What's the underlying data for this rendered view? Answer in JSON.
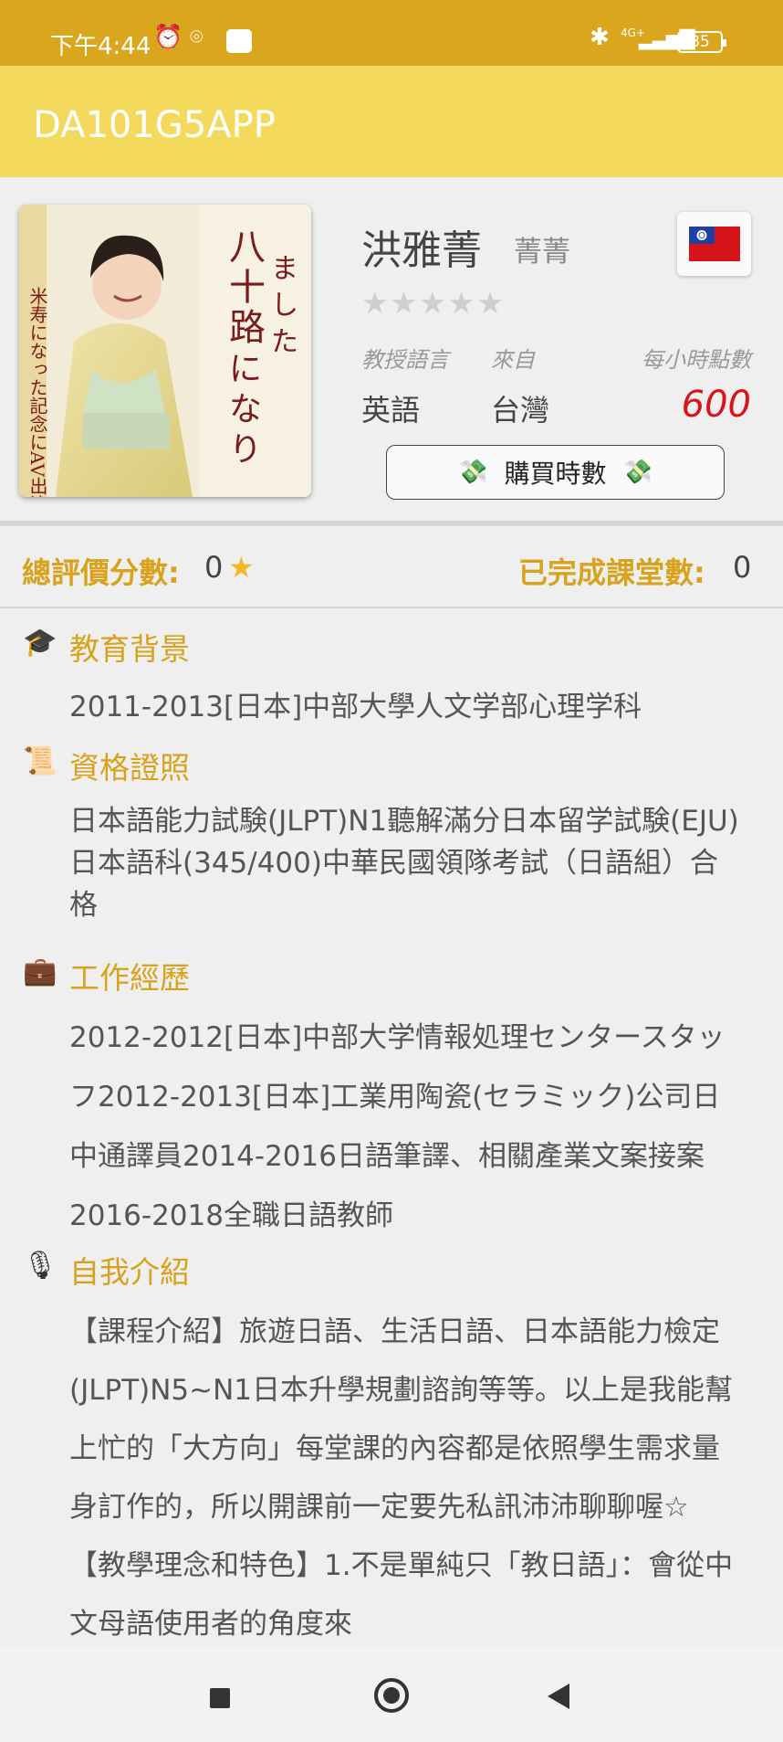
{
  "status_bar": {
    "time": "下午4:44",
    "network": "4G+",
    "battery": "85",
    "icons": [
      "alarm-icon",
      "app-notification-icon",
      "app-square-icon",
      "bluetooth-icon",
      "signal-icon"
    ]
  },
  "app_bar": {
    "title": "DA101G5APP"
  },
  "teacher": {
    "name": "洪雅菁",
    "nickname": "菁菁",
    "flag": "taiwan-flag",
    "rating_stars": 0,
    "labels": {
      "language": "教授語言",
      "from": "來自",
      "rate": "每小時點數"
    },
    "language": "英語",
    "from": "台灣",
    "rate": "600",
    "buy_button": "購買時數"
  },
  "summary": {
    "rating_label": "總評價分數:",
    "rating_value": "0",
    "classes_label": "已完成課堂數:",
    "classes_value": "0"
  },
  "sections": {
    "education": {
      "icon": "graduation-cap-icon",
      "title": "教育背景",
      "body": "2011-2013[日本]中部大學人文学部心理学科"
    },
    "certificates": {
      "icon": "scroll-icon",
      "title": "資格證照",
      "body": "日本語能力試験(JLPT)N1聽解滿分日本留学試験(EJU)日本語科(345/400)中華民國領隊考試（日語組）合格"
    },
    "work": {
      "icon": "briefcase-icon",
      "title": "工作經歷",
      "body": "2012-2012[日本]中部大学情報処理センタースタッフ2012-2013[日本]工業用陶瓷(セラミック)公司日中通譯員2014-2016日語筆譯、相關產業文案接案2016-2018全職日語教師"
    },
    "intro": {
      "icon": "microphone-icon",
      "title": "自我介紹",
      "body": "【課程介紹】旅遊日語、生活日語、日本語能力檢定(JLPT)N5~N1日本升學規劃諮詢等等。以上是我能幫上忙的「大方向」每堂課的內容都是依照學生需求量身訂作的，所以開課前一定要先私訊沛沛聊聊喔☆【教學理念和特色】1.不是單純只「教日語」：會從中文母語使用者的角度來"
    }
  },
  "nav_bar": {
    "icons": [
      "recents-square-icon",
      "home-circle-icon",
      "back-triangle-icon"
    ]
  },
  "colors": {
    "status_bar": "#d9a61e",
    "app_bar": "#f3d95c",
    "accent": "#d8a21d",
    "rate": "#d9141c"
  }
}
